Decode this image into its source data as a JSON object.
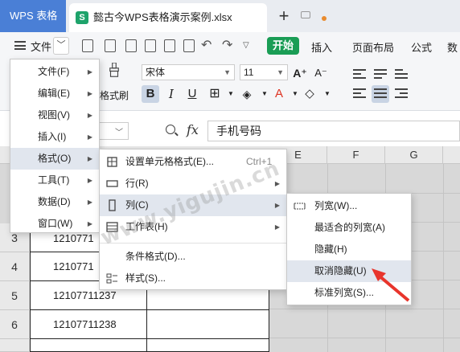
{
  "app_tab": "WPS 表格",
  "doc_tab": {
    "icon": "S",
    "title": "懿古今WPS表格演示案例.xlsx"
  },
  "toolbar": {
    "file_label": "文件",
    "start_label": "开始",
    "tabs": [
      "插入",
      "页面布局",
      "公式",
      "数"
    ]
  },
  "ribbon": {
    "format_painter": "格式刷",
    "font_name": "宋体",
    "font_size": "11",
    "bold": "B",
    "italic": "I",
    "underline": "U"
  },
  "formula_bar": {
    "fx": "fx",
    "value": "手机号码"
  },
  "columns": [
    "E",
    "F",
    "G"
  ],
  "rows": [
    {
      "num": "3",
      "b": "1210771"
    },
    {
      "num": "4",
      "b": "1210771"
    },
    {
      "num": "5",
      "b": "12107711237"
    },
    {
      "num": "6",
      "b": "12107711238"
    }
  ],
  "file_menu": [
    {
      "label": "文件(F)",
      "active": false
    },
    {
      "label": "编辑(E)",
      "active": false
    },
    {
      "label": "视图(V)",
      "active": false
    },
    {
      "label": "插入(I)",
      "active": false
    },
    {
      "label": "格式(O)",
      "active": true
    },
    {
      "label": "工具(T)",
      "active": false
    },
    {
      "label": "数据(D)",
      "active": false
    },
    {
      "label": "窗口(W)",
      "active": false
    }
  ],
  "format_menu": [
    {
      "label": "设置单元格格式(E)...",
      "shortcut": "Ctrl+1",
      "icon": "format-cells-icon"
    },
    {
      "label": "行(R)",
      "icon": "row-icon"
    },
    {
      "label": "列(C)",
      "icon": "column-icon"
    },
    {
      "label": "工作表(H)",
      "icon": "sheet-icon"
    },
    {
      "label": "条件格式(D)..."
    },
    {
      "label": "样式(S)...",
      "icon": "style-icon"
    }
  ],
  "column_menu": [
    {
      "label": "列宽(W)...",
      "icon": "column-width-icon"
    },
    {
      "label": "最适合的列宽(A)"
    },
    {
      "label": "隐藏(H)"
    },
    {
      "label": "取消隐藏(U)"
    },
    {
      "label": "标准列宽(S)..."
    }
  ],
  "watermark": "www.yigujin.cn",
  "colors": {
    "accent": "#4a7fd6",
    "start_green": "#1a9d55",
    "highlight": "#e1e6ee",
    "arrow": "#e8352c"
  }
}
